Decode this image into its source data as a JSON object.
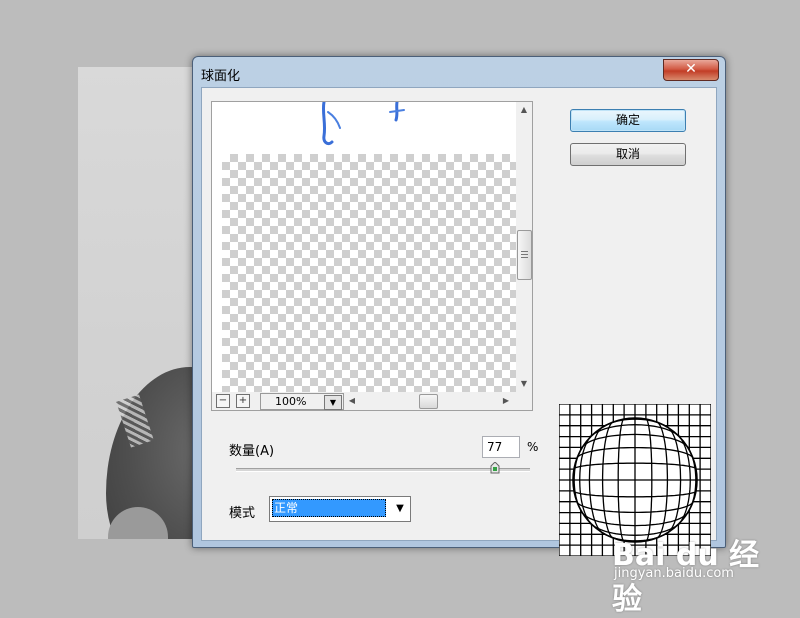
{
  "dialog": {
    "title": "球面化",
    "close_label": "✕"
  },
  "buttons": {
    "ok_label": "确定",
    "cancel_label": "取消"
  },
  "preview": {
    "zoom_value": "100%",
    "zoom_out_label": "−",
    "zoom_in_label": "+"
  },
  "amount": {
    "label": "数量(A)",
    "value": "77",
    "unit": "%",
    "slider_fraction": 0.88
  },
  "mode": {
    "label": "模式",
    "value": "正常"
  },
  "watermark": {
    "logo": "Bai du 经验",
    "url": "jingyan.baidu.com"
  },
  "colors": {
    "selection": "#3399ff",
    "default_button_border": "#3c7fb1",
    "close_button": "#c23d26"
  }
}
